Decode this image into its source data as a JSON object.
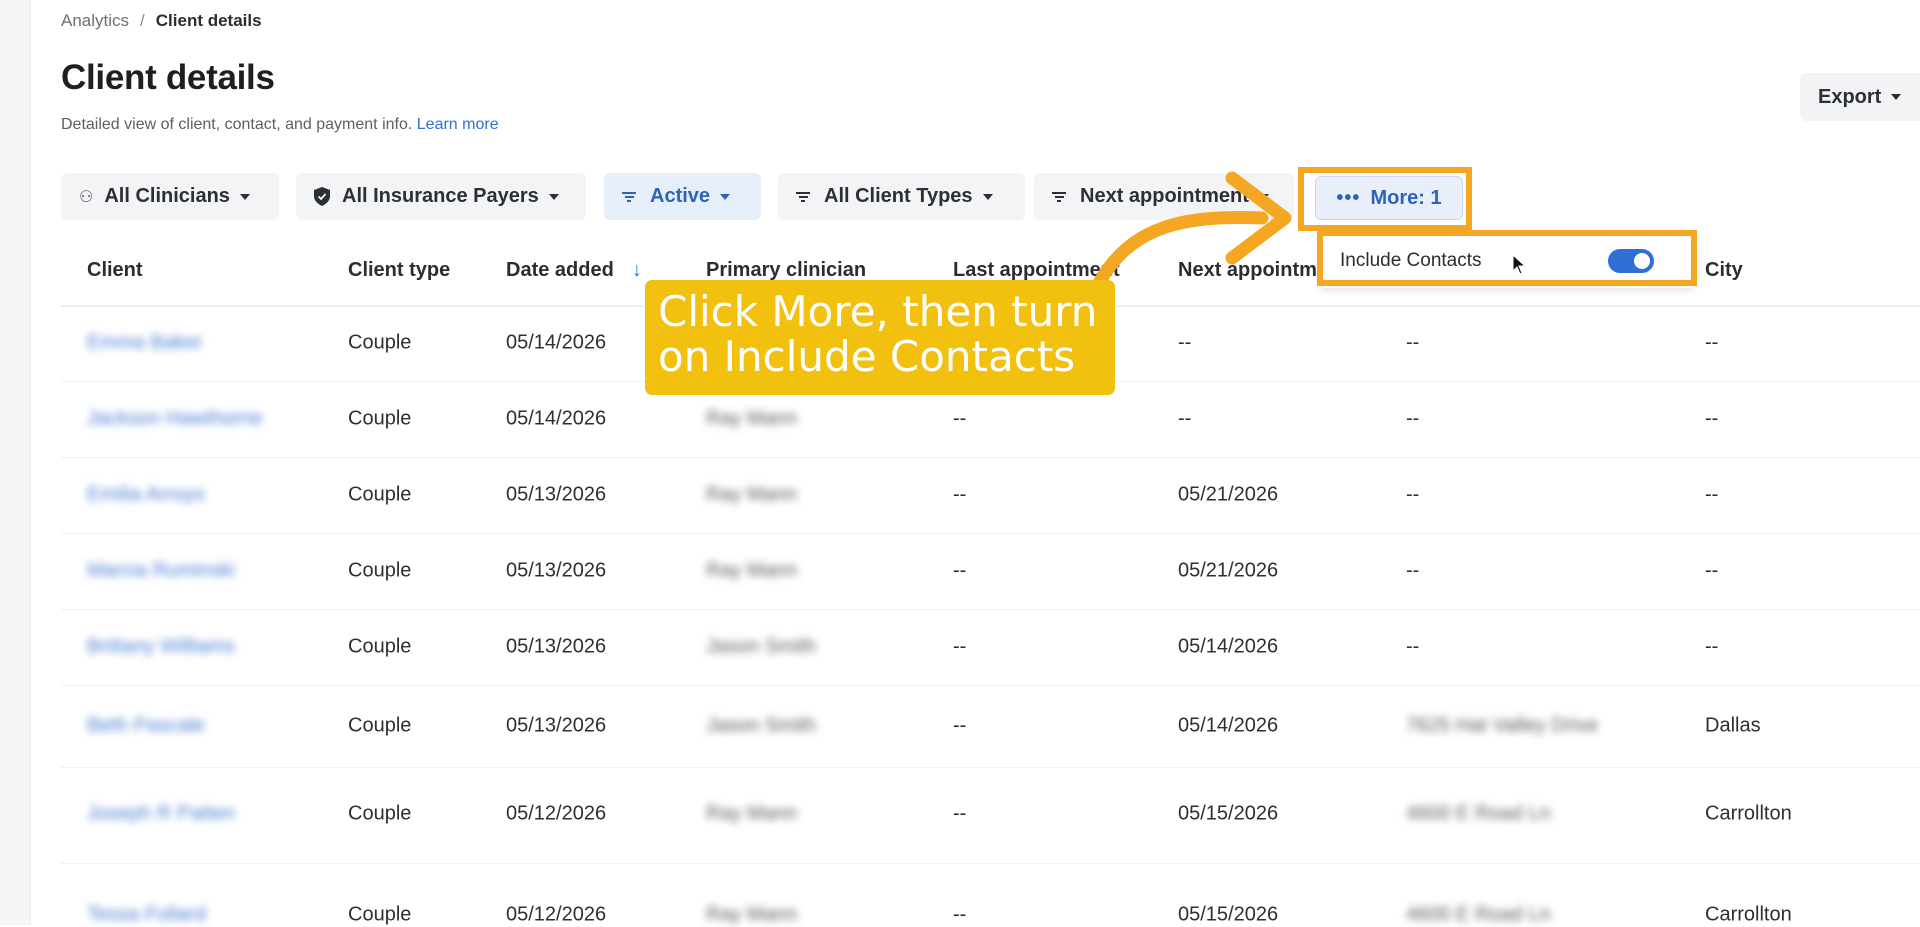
{
  "breadcrumb": {
    "parent": "Analytics",
    "separator": "/",
    "current": "Client details"
  },
  "page": {
    "title": "Client details",
    "subtitle": "Detailed view of client, contact, and payment info.",
    "learn_more": "Learn more"
  },
  "export_label": "Export",
  "filters": {
    "clinicians": "All Clinicians",
    "insurance": "All Insurance Payers",
    "status": "Active",
    "client_types": "All Client Types",
    "next_appointment": "Next appointment",
    "more": "More: 1"
  },
  "dropdown": {
    "include_contacts": "Include Contacts",
    "toggle_on": true
  },
  "callout": {
    "line1": "Click More, then turn",
    "line2": "on Include Contacts"
  },
  "columns": {
    "client": "Client",
    "client_type": "Client type",
    "date_added": "Date added",
    "sort_icon": "↓",
    "primary_clinician": "Primary clinician",
    "last_appointment": "Last appointment",
    "next_appointment": "Next appointm",
    "city": "City"
  },
  "rows": [
    {
      "client": "Emma Baker",
      "type": "Couple",
      "date": "05/14/2026",
      "clinician": "",
      "last": "",
      "next": "--",
      "address": "--",
      "city": "--"
    },
    {
      "client": "Jackson Hawthorne",
      "type": "Couple",
      "date": "05/14/2026",
      "clinician": "Ray Mann",
      "last": "--",
      "next": "--",
      "address": "--",
      "city": "--"
    },
    {
      "client": "Emilia Arroyo",
      "type": "Couple",
      "date": "05/13/2026",
      "clinician": "Ray Mann",
      "last": "--",
      "next": "05/21/2026",
      "address": "--",
      "city": "--"
    },
    {
      "client": "Marcia Ruminski",
      "type": "Couple",
      "date": "05/13/2026",
      "clinician": "Ray Mann",
      "last": "--",
      "next": "05/21/2026",
      "address": "--",
      "city": "--"
    },
    {
      "client": "Brittany Williams",
      "type": "Couple",
      "date": "05/13/2026",
      "clinician": "Jason Smith",
      "last": "--",
      "next": "05/14/2026",
      "address": "--",
      "city": "--"
    },
    {
      "client": "Beth Pascale",
      "type": "Couple",
      "date": "05/13/2026",
      "clinician": "Jason Smith",
      "last": "--",
      "next": "05/14/2026",
      "address": "7625 Hat Valley Drive",
      "city": "Dallas"
    },
    {
      "client": "Joseph R Patten",
      "type": "Couple",
      "date": "05/12/2026",
      "clinician": "Ray Mann",
      "last": "--",
      "next": "05/15/2026",
      "address": "4600 E Road Ln",
      "city": "Carrollton"
    },
    {
      "client": "Tessa Follard",
      "type": "Couple",
      "date": "05/12/2026",
      "clinician": "Ray Mann",
      "last": "--",
      "next": "05/15/2026",
      "address": "4600 E Road Ln",
      "city": "Carrollton"
    }
  ],
  "colors": {
    "accent": "#2f6fd6",
    "highlight": "#f5a623",
    "callout_bg": "#f2c10f"
  }
}
